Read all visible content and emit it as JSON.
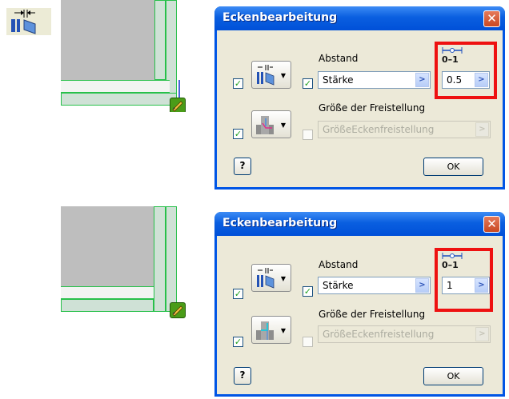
{
  "tool": {
    "icon": "corner-gap-icon"
  },
  "dialogs": [
    {
      "title": "Eckenbearbeitung",
      "close_icon": "close-icon",
      "gap_label": "Abstand",
      "gap_mode_icon": "corner-gap-icon",
      "gap_value_type": "Stärke",
      "gap_value": "0.5",
      "param_icon": "measure-icon",
      "param_text": "0–1",
      "relief_label": "Größe der Freistellung",
      "relief_value": "GrößeEckenfreistellung",
      "relief_icon": "corner-relief-icon",
      "help": "?",
      "ok": "OK"
    },
    {
      "title": "Eckenbearbeitung",
      "close_icon": "close-icon",
      "gap_label": "Abstand",
      "gap_mode_icon": "corner-gap-icon",
      "gap_value_type": "Stärke",
      "gap_value": "1",
      "param_icon": "measure-icon",
      "param_text": "0–1",
      "relief_label": "Größe der Freistellung",
      "relief_value": "GrößeEckenfreistellung",
      "relief_icon": "corner-relief-icon",
      "help": "?",
      "ok": "OK"
    }
  ],
  "colors": {
    "highlight": "#ee1111",
    "titlebar": "#0a5fe0",
    "edge": "#27c04a"
  }
}
